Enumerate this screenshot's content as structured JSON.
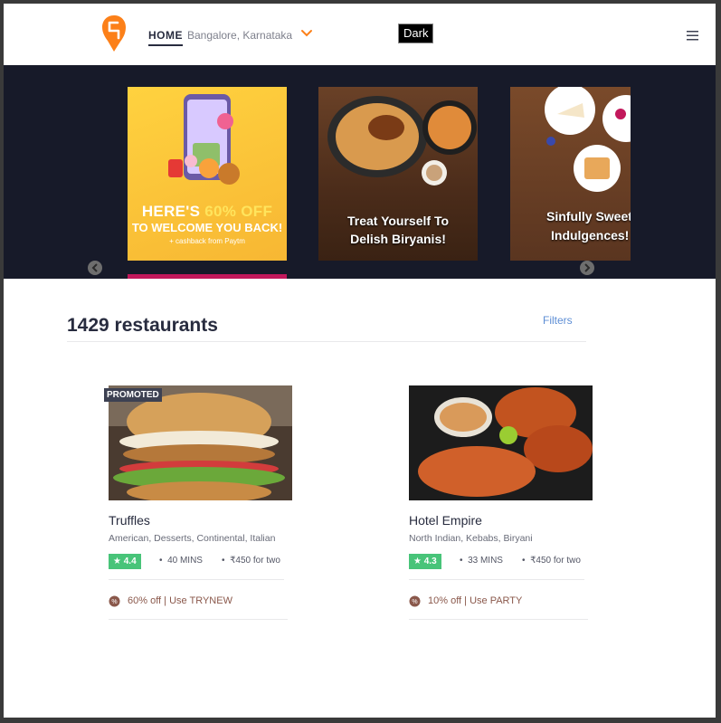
{
  "header": {
    "home_label": "HOME",
    "location": "Bangalore, Karnataka",
    "dark_label": "Dark",
    "brand_color": "#fc8019"
  },
  "carousel": {
    "cards": [
      {
        "title_part1": "HERE'S ",
        "title_highlight": "60% OFF",
        "line2": "TO WELCOME YOU BACK!",
        "line3": "+ cashback from Paytm"
      },
      {
        "line1": "Treat Yourself To",
        "line2": "Delish Biryanis!"
      },
      {
        "line1": "Sinfully Sweet",
        "line2": "Indulgences!"
      }
    ]
  },
  "main": {
    "count": "1429 restaurants",
    "filters_label": "Filters"
  },
  "restaurants": [
    {
      "badge": "PROMOTED",
      "name": "Truffles",
      "cuisine": "American, Desserts, Continental, Italian",
      "rating": "4.4",
      "time": "40 MINS",
      "cost": "₹450 for two",
      "offer": "60% off | Use TRYNEW",
      "rating_color": "#48c479"
    },
    {
      "name": "Hotel Empire",
      "cuisine": "North Indian, Kebabs, Biryani",
      "rating": "4.3",
      "time": "33 MINS",
      "cost": "₹450 for two",
      "offer": "10% off | Use PARTY",
      "rating_color": "#48c479"
    }
  ]
}
